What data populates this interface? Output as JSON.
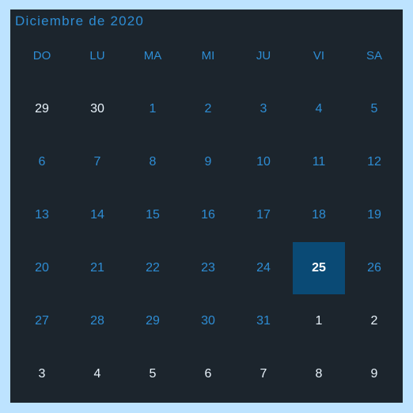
{
  "calendar": {
    "title": "Diciembre de 2020",
    "weekdays": [
      "DO",
      "LU",
      "MA",
      "MI",
      "JU",
      "VI",
      "SA"
    ],
    "selected_day": "25",
    "weeks": [
      [
        {
          "label": "29",
          "in_month": false
        },
        {
          "label": "30",
          "in_month": false
        },
        {
          "label": "1",
          "in_month": true
        },
        {
          "label": "2",
          "in_month": true
        },
        {
          "label": "3",
          "in_month": true
        },
        {
          "label": "4",
          "in_month": true
        },
        {
          "label": "5",
          "in_month": true
        }
      ],
      [
        {
          "label": "6",
          "in_month": true
        },
        {
          "label": "7",
          "in_month": true
        },
        {
          "label": "8",
          "in_month": true
        },
        {
          "label": "9",
          "in_month": true
        },
        {
          "label": "10",
          "in_month": true
        },
        {
          "label": "11",
          "in_month": true
        },
        {
          "label": "12",
          "in_month": true
        }
      ],
      [
        {
          "label": "13",
          "in_month": true
        },
        {
          "label": "14",
          "in_month": true
        },
        {
          "label": "15",
          "in_month": true
        },
        {
          "label": "16",
          "in_month": true
        },
        {
          "label": "17",
          "in_month": true
        },
        {
          "label": "18",
          "in_month": true
        },
        {
          "label": "19",
          "in_month": true
        }
      ],
      [
        {
          "label": "20",
          "in_month": true
        },
        {
          "label": "21",
          "in_month": true
        },
        {
          "label": "22",
          "in_month": true
        },
        {
          "label": "23",
          "in_month": true
        },
        {
          "label": "24",
          "in_month": true
        },
        {
          "label": "25",
          "in_month": true,
          "selected": true
        },
        {
          "label": "26",
          "in_month": true
        }
      ],
      [
        {
          "label": "27",
          "in_month": true
        },
        {
          "label": "28",
          "in_month": true
        },
        {
          "label": "29",
          "in_month": true
        },
        {
          "label": "30",
          "in_month": true
        },
        {
          "label": "31",
          "in_month": true
        },
        {
          "label": "1",
          "in_month": false
        },
        {
          "label": "2",
          "in_month": false
        }
      ],
      [
        {
          "label": "3",
          "in_month": false
        },
        {
          "label": "4",
          "in_month": false
        },
        {
          "label": "5",
          "in_month": false
        },
        {
          "label": "6",
          "in_month": false
        },
        {
          "label": "7",
          "in_month": false
        },
        {
          "label": "8",
          "in_month": false
        },
        {
          "label": "9",
          "in_month": false
        }
      ]
    ]
  },
  "colors": {
    "page_background": "#bde3ff",
    "calendar_background": "#1c252d",
    "accent_text": "#2e8dd4",
    "out_of_month_text": "#e9f3fb",
    "selected_background": "#0a4a75"
  }
}
